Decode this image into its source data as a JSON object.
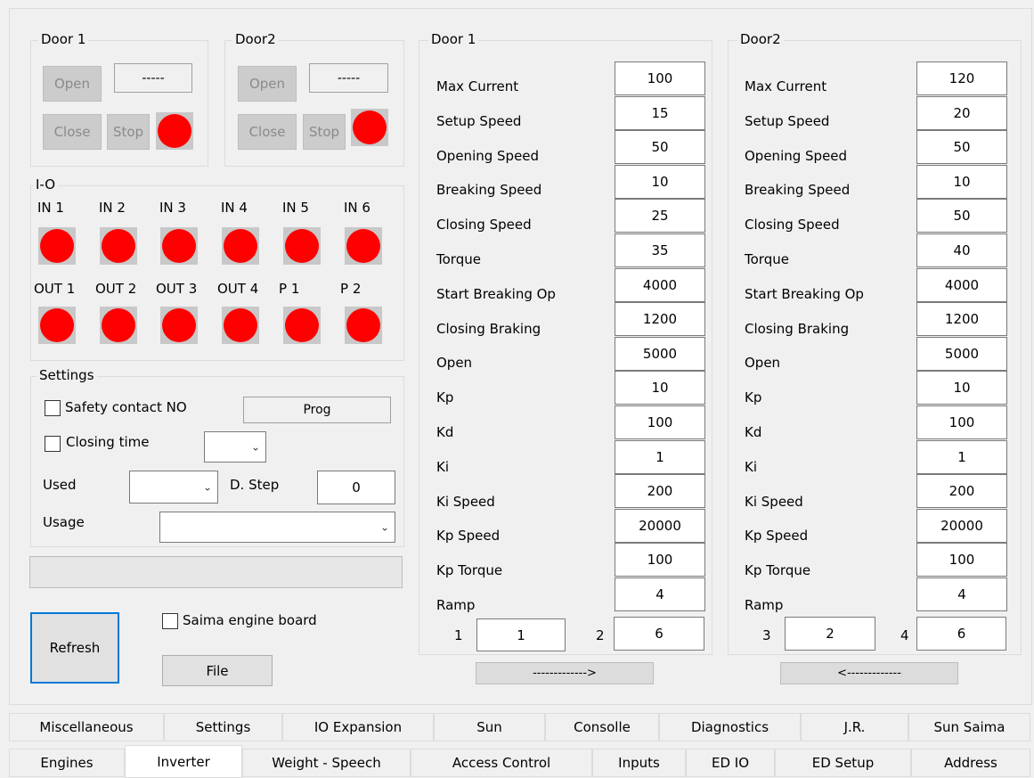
{
  "door1_control": {
    "title": "Door 1",
    "open": "Open",
    "close": "Close",
    "stop": "Stop",
    "display": "-----"
  },
  "door2_control": {
    "title": "Door2",
    "open": "Open",
    "close": "Close",
    "stop": "Stop",
    "display": "-----"
  },
  "io": {
    "title": "I-O",
    "inputs": [
      "IN 1",
      "IN 2",
      "IN 3",
      "IN 4",
      "IN 5",
      "IN 6"
    ],
    "outputs": [
      "OUT 1",
      "OUT 2",
      "OUT 3",
      "OUT 4",
      "P 1",
      "P 2"
    ],
    "led_color": "#ff0000"
  },
  "settings": {
    "title": "Settings",
    "safety_contact": "Safety contact NO",
    "prog": "Prog",
    "closing_time": "Closing time",
    "used": "Used",
    "d_step": "D. Step",
    "d_step_value": "0",
    "usage": "Usage"
  },
  "refresh": "Refresh",
  "saima_engine_board": "Saima engine board",
  "file": "File",
  "param_labels": [
    "Max Current",
    "Setup Speed",
    "Opening Speed",
    "Breaking Speed",
    "Closing Speed",
    "Torque",
    "Start Breaking Op",
    "Closing Braking",
    "Open",
    "Kp",
    "Kd",
    "Ki",
    "Ki Speed",
    "Kp Speed",
    "Kp Torque",
    "Ramp"
  ],
  "door1_params": {
    "title": "Door 1",
    "values": [
      "100",
      "15",
      "50",
      "10",
      "25",
      "35",
      "4000",
      "1200",
      "5000",
      "10",
      "100",
      "1",
      "200",
      "20000",
      "100",
      "4"
    ],
    "idx_a_label": "1",
    "idx_a_value": "1",
    "idx_b_label": "2",
    "idx_b_value": "6",
    "copy_button": "------------->"
  },
  "door2_params": {
    "title": "Door2",
    "values": [
      "120",
      "20",
      "50",
      "10",
      "50",
      "40",
      "4000",
      "1200",
      "5000",
      "10",
      "100",
      "1",
      "200",
      "20000",
      "100",
      "4"
    ],
    "idx_a_label": "3",
    "idx_a_value": "2",
    "idx_b_label": "4",
    "idx_b_value": "6",
    "copy_button": "<-------------"
  },
  "tabs_row1": [
    "Miscellaneous",
    "Settings",
    "IO Expansion",
    "Sun",
    "Consolle",
    "Diagnostics",
    "J.R.",
    "Sun Saima"
  ],
  "tabs_row2": [
    "Engines",
    "Inverter",
    "Weight - Speech",
    "Access Control",
    "Inputs",
    "ED IO",
    "ED Setup",
    "Address"
  ],
  "selected_tab": "Inverter"
}
